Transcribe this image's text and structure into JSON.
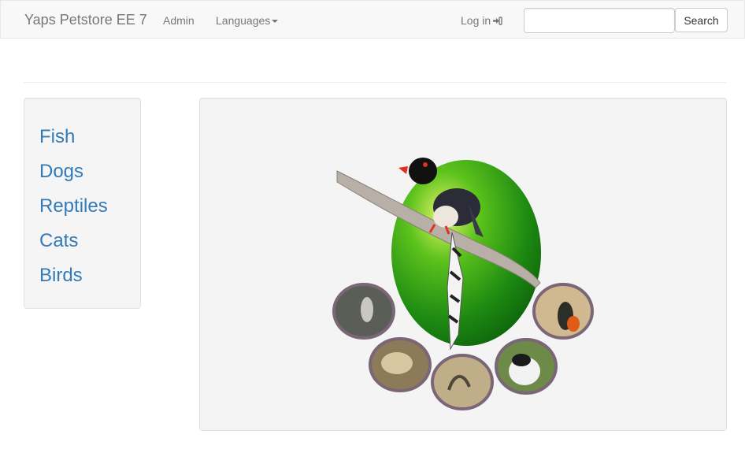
{
  "navbar": {
    "brand": "Yaps Petstore EE 7",
    "admin": "Admin",
    "languages": "Languages",
    "login": "Log in",
    "search_button": "Search",
    "search_value": ""
  },
  "categories": [
    "Fish",
    "Dogs",
    "Reptiles",
    "Cats",
    "Birds"
  ],
  "colors": {
    "link": "#337ab7",
    "navbar_bg": "#f8f8f8",
    "panel_bg": "#f5f5f5"
  },
  "hero": {
    "icons": [
      "bird-icon",
      "fish-thumbnail-icon",
      "dog-thumbnail-icon",
      "reptile-thumbnail-icon",
      "cat-thumbnail-icon",
      "bird-thumbnail-icon"
    ]
  }
}
